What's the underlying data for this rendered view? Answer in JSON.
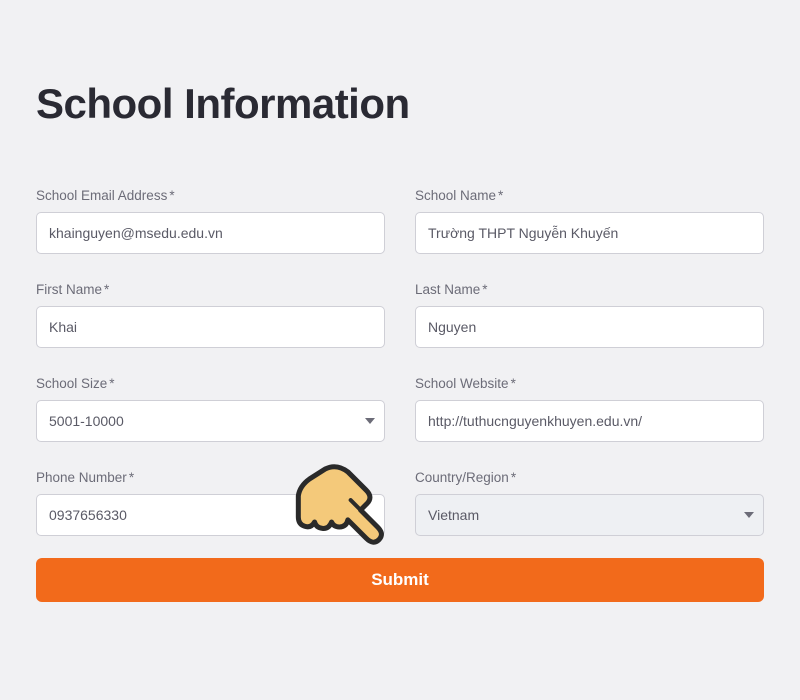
{
  "title": "School Information",
  "required_mark": "*",
  "labels": {
    "email": "School Email Address",
    "school_name": "School Name",
    "first_name": "First Name",
    "last_name": "Last Name",
    "school_size": "School Size",
    "school_website": "School Website",
    "phone": "Phone Number",
    "country": "Country/Region"
  },
  "values": {
    "email": "khainguyen@msedu.edu.vn",
    "school_name": "Trường THPT Nguyễn Khuyến",
    "first_name": "Khai",
    "last_name": "Nguyen",
    "school_size": "5001-10000",
    "school_website": "http://tuthucnguyenkhuyen.edu.vn/",
    "phone": "0937656330",
    "country": "Vietnam"
  },
  "buttons": {
    "submit": "Submit"
  },
  "colors": {
    "accent": "#f26a1b",
    "page_bg": "#f1f1f3"
  }
}
